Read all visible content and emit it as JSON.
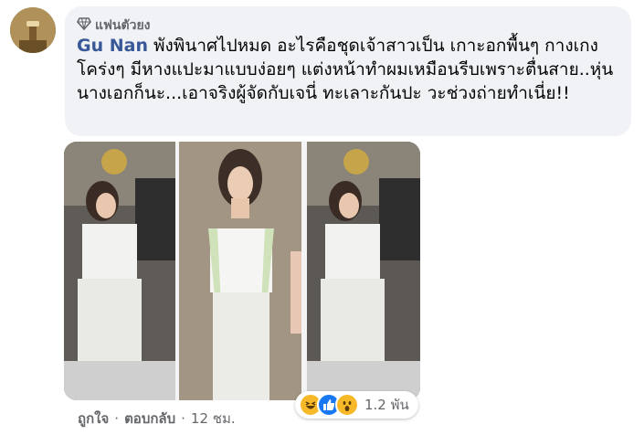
{
  "comment": {
    "badge_label": "แฟนตัวยง",
    "author": "Gu Nan",
    "text": "พังพินาศไปหมด อะไรคือชุดเจ้าสาวเป็น เกาะอกพื้นๆ กางเกงโคร่งๆ มีหางแปะมาแบบง่อยๆ แต่งหน้าทำผมเหมือนรีบเพราะตื่นสาย..หุ่นนางเอกก็นะ...เอาจริงผู้จัดกับเจนี่ ทะเลาะกันปะ วะช่วงถ่ายทำเนี่ย!!"
  },
  "actions": {
    "like_label": "ถูกใจ",
    "separator": "·",
    "reply_label": "ตอบกลับ",
    "timestamp": "12 ชม."
  },
  "reactions": {
    "types": [
      "haha-icon",
      "like-icon",
      "wow-icon"
    ],
    "count": "1.2 พัน"
  },
  "colors": {
    "bubble": "#f0f2f5",
    "author": "#385898",
    "meta": "#65676b",
    "like_blue": "#1877f2",
    "haha_yellow": "#f7b928"
  }
}
